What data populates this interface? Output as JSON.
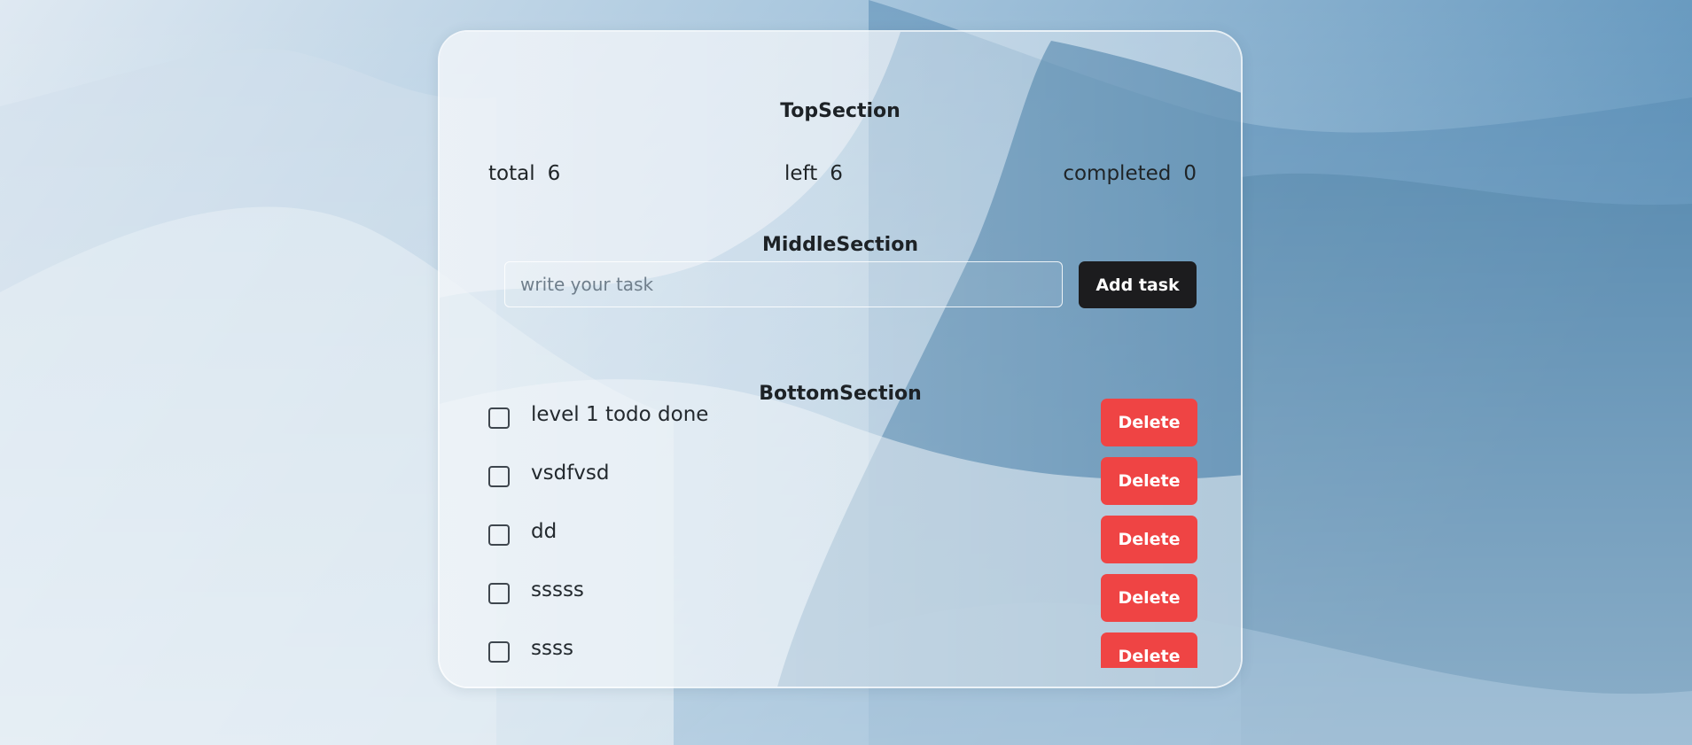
{
  "top_section": {
    "title": "TopSection",
    "stats": [
      {
        "label": "total",
        "value": "6"
      },
      {
        "label": "left",
        "value": "6"
      },
      {
        "label": "completed",
        "value": "0"
      }
    ]
  },
  "middle_section": {
    "title": "MiddleSection",
    "input_placeholder": "write your task",
    "input_value": "",
    "add_button_label": "Add task"
  },
  "bottom_section": {
    "title": "BottomSection",
    "delete_label": "Delete",
    "todos": [
      {
        "text": "level 1 todo done",
        "done": false
      },
      {
        "text": "vsdfvsd",
        "done": false
      },
      {
        "text": "dd",
        "done": false
      },
      {
        "text": "sssss",
        "done": false
      },
      {
        "text": "ssss",
        "done": false
      },
      {
        "text": "",
        "done": false
      }
    ]
  },
  "colors": {
    "add_button": "#1c1c1e",
    "delete_button": "#ef4444",
    "text": "#1f2427"
  }
}
